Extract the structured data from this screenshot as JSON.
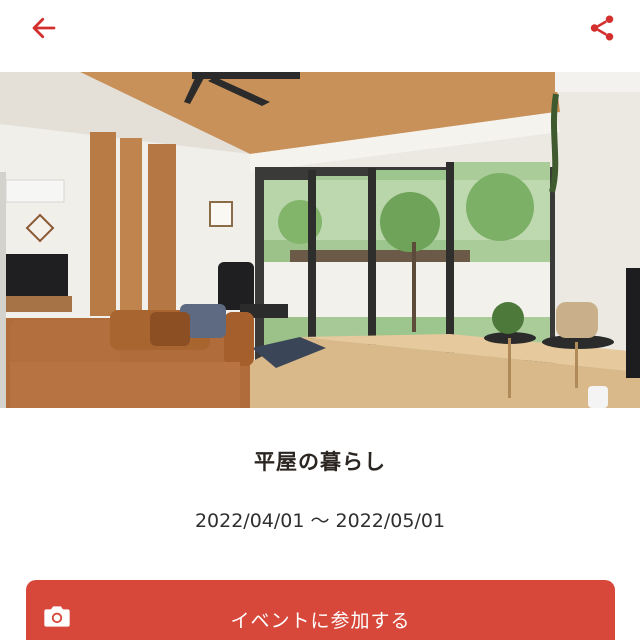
{
  "header": {
    "back_icon": "arrow-left-icon",
    "share_icon": "share-icon",
    "icon_color": "#d32f2f"
  },
  "event": {
    "title": "平屋の暮らし",
    "period": "2022/04/01 〜 2022/05/01"
  },
  "join_button": {
    "label": "イベントに参加する",
    "icon": "camera-icon",
    "color": "#d7483b"
  }
}
